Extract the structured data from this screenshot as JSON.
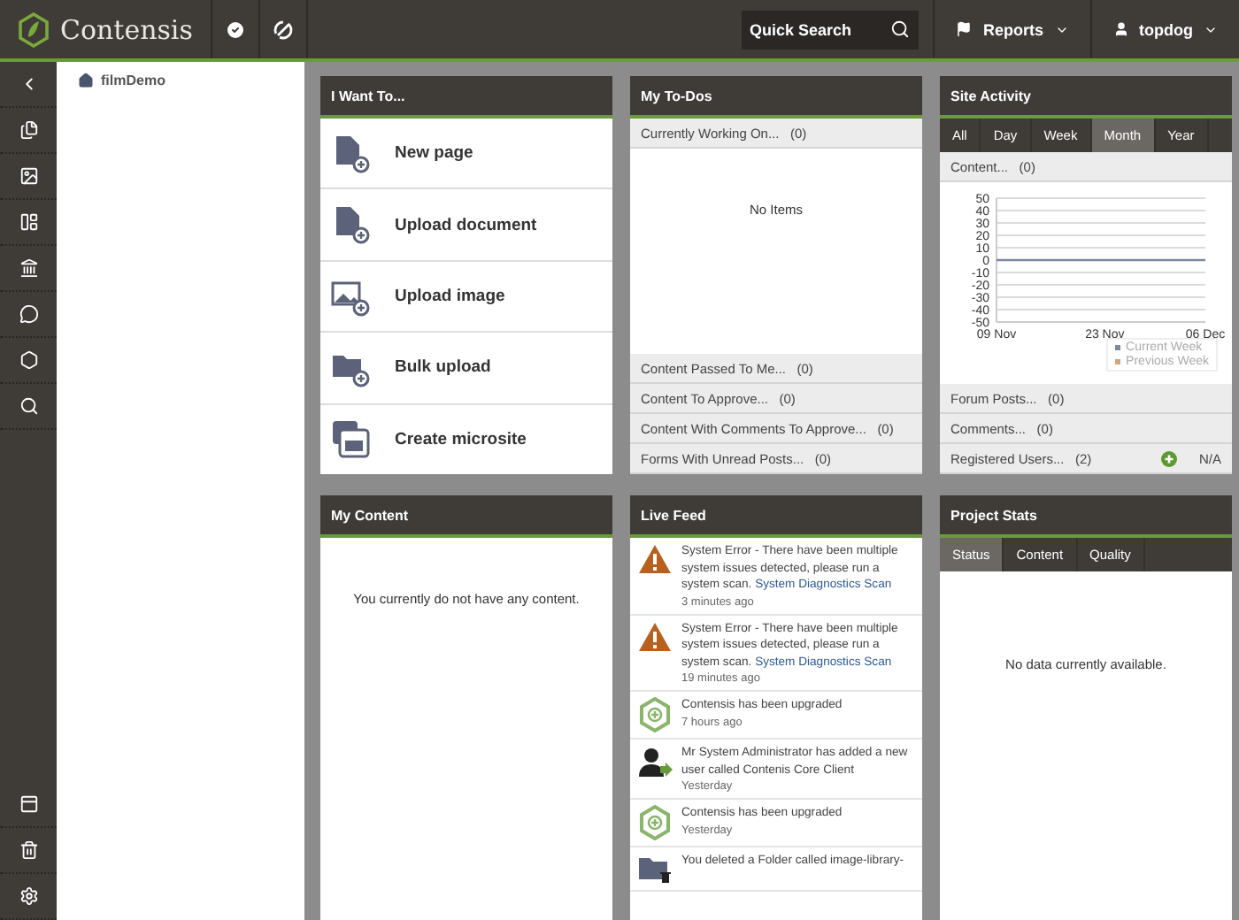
{
  "topbar": {
    "brand": "Contensis",
    "search": {
      "placeholder": "Quick Search"
    },
    "menus": [
      {
        "label": "Reports",
        "kind": "reports"
      },
      {
        "label": "topdog",
        "kind": "user"
      }
    ]
  },
  "tree": {
    "root": "filmDemo"
  },
  "widgets": [
    {
      "kind": "actions",
      "title": "I Want To...",
      "items": [
        {
          "kind": "page",
          "label": "New page"
        },
        {
          "kind": "document",
          "label": "Upload document"
        },
        {
          "kind": "image",
          "label": "Upload image"
        },
        {
          "kind": "bulk",
          "label": "Bulk upload"
        },
        {
          "kind": "microsite",
          "label": "Create microsite"
        }
      ]
    },
    {
      "kind": "todos",
      "title": "My To-Dos",
      "top": {
        "label": "Currently Working On...",
        "count": "(0)"
      },
      "empty": "No Items",
      "sections": [
        {
          "label": "Content Passed To Me...",
          "count": "(0)"
        },
        {
          "label": "Content To Approve...",
          "count": "(0)"
        },
        {
          "label": "Content With Comments To Approve...",
          "count": "(0)"
        },
        {
          "label": "Forms With Unread Posts...",
          "count": "(0)"
        }
      ]
    },
    {
      "kind": "activity",
      "title": "Site Activity",
      "tabs": [
        {
          "label": "All",
          "selected": false
        },
        {
          "label": "Day",
          "selected": false
        },
        {
          "label": "Week",
          "selected": false
        },
        {
          "label": "Month",
          "selected": true
        },
        {
          "label": "Year",
          "selected": false
        }
      ],
      "top": {
        "label": "Content...",
        "count": "(0)"
      },
      "chart_data": {
        "type": "line",
        "categories": [
          "09 Nov",
          null,
          null,
          null,
          null,
          null,
          null,
          null,
          null,
          null,
          null,
          null,
          null,
          null,
          "23 Nov",
          null,
          null,
          null,
          null,
          null,
          null,
          null,
          null,
          null,
          null,
          null,
          null,
          "06 Dec"
        ],
        "ylim": [
          -50,
          50
        ],
        "grid": true,
        "yticks": [
          -50,
          -40,
          -30,
          -20,
          -10,
          0,
          10,
          20,
          30,
          40,
          50
        ],
        "series": [
          {
            "name": "Previous Week",
            "color": "#d4a57a",
            "values": [
              null,
              null,
              null,
              null,
              null,
              null,
              null,
              null,
              null,
              null,
              null,
              null,
              null,
              null,
              null,
              null,
              null,
              null,
              null,
              null,
              null,
              null,
              null,
              null,
              null,
              null,
              null,
              null
            ]
          },
          {
            "name": "Current Week",
            "color": "#7d87a0",
            "values": [
              0,
              0,
              0,
              0,
              0,
              0,
              0,
              0,
              0,
              0,
              0,
              0,
              0,
              0,
              0,
              0,
              0,
              0,
              0,
              0,
              0,
              0,
              0,
              0,
              0,
              0,
              0,
              0
            ]
          }
        ]
      },
      "sections": [
        {
          "label": "Forum Posts...",
          "count": "(0)"
        },
        {
          "label": "Comments...",
          "count": "(0)"
        },
        {
          "label": "Registered Users...",
          "count": "(2)",
          "value": "N/A"
        }
      ]
    },
    {
      "kind": "content",
      "title": "My Content",
      "empty": "You currently do not have any content."
    },
    {
      "kind": "feed",
      "title": "Live Feed",
      "items": [
        {
          "kind": "error",
          "text": "System Error - There have been multiple system issues detected, please run a system scan.",
          "link": "System Diagnostics Scan",
          "time": "3 minutes ago"
        },
        {
          "kind": "error",
          "text": "System Error - There have been multiple system issues detected, please run a system scan.",
          "link": "System Diagnostics Scan",
          "time": "19 minutes ago"
        },
        {
          "kind": "upgrade",
          "text": "Contensis has been upgraded",
          "time": "7 hours ago"
        },
        {
          "kind": "user",
          "text": "Mr System Administrator has added a new user called Contenis Core Client",
          "time": "Yesterday"
        },
        {
          "kind": "upgrade",
          "text": "Contensis has been upgraded",
          "time": "Yesterday"
        },
        {
          "kind": "folder",
          "text": "You deleted a Folder called image-library-"
        }
      ]
    },
    {
      "kind": "stats",
      "title": "Project Stats",
      "tabs": [
        {
          "label": "Status",
          "selected": true
        },
        {
          "label": "Content",
          "selected": false
        },
        {
          "label": "Quality",
          "selected": false
        }
      ],
      "empty": "No data currently available."
    }
  ]
}
